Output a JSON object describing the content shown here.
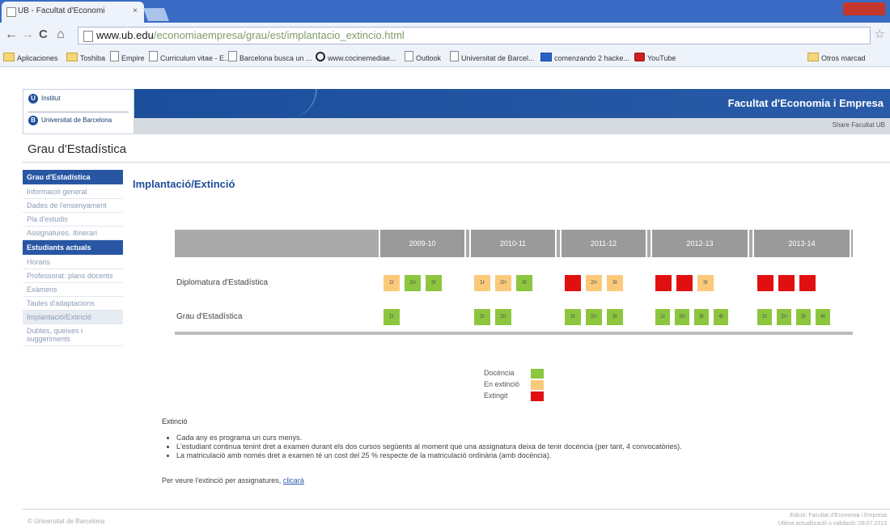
{
  "browser": {
    "tab_title": "UB - Facultat d'Economi",
    "tab_close": "×",
    "url_host": "www.ub.edu",
    "url_path": "/economiaempresa/grau/est/implantacio_extincio.html",
    "back": "←",
    "forward": "→",
    "reload": "C",
    "home": "⌂",
    "star": "☆"
  },
  "bookmarks": [
    {
      "label": "Aplicaciones",
      "icon": "apps-icon"
    },
    {
      "label": "Toshiba",
      "icon": "folder-icon"
    },
    {
      "label": "Empire",
      "icon": "page-icon"
    },
    {
      "label": "Curriculum vitae - E...",
      "icon": "page-icon"
    },
    {
      "label": "Barcelona busca un ...",
      "icon": "page-icon"
    },
    {
      "label": "www.cocinemediae...",
      "icon": "opera-icon"
    },
    {
      "label": "Outlook",
      "icon": "page-icon"
    },
    {
      "label": "Universitat de Barcel...",
      "icon": "page-icon"
    },
    {
      "label": "comenzando 2 hacke...",
      "icon": "blue-icon"
    },
    {
      "label": "YouTube",
      "icon": "youtube-icon"
    },
    {
      "label": "Otros marcad",
      "icon": "folder-icon"
    }
  ],
  "header": {
    "logo_top": "Institut",
    "logo_bottom": "Universitat de Barcelona",
    "faculty": "Facultat d'Economia i Empresa",
    "grey_links": "Share   Facultat   UB"
  },
  "site_title": "Grau d'Estadística",
  "sidebar": {
    "sections": [
      {
        "head": "Grau d'Estadística",
        "items": [
          "Informació general",
          "Dades de l'ensenyament",
          "Pla d'estudis",
          "Assignatures. Itinerari"
        ]
      },
      {
        "head": "Estudiants actuals",
        "items": [
          "Horaris",
          "Professorat: plans docents",
          "Exàmens",
          "Taules d'adaptacions",
          "Implantació/Extinció",
          "Dubtes, queixes i suggeriments"
        ]
      }
    ],
    "active": "Implantació/Extinció"
  },
  "main_title": "Implantació/Extinció",
  "timeline": {
    "years": [
      "2009-10",
      "2010-11",
      "2011-12",
      "2012-13",
      "2013-14"
    ],
    "rows": [
      {
        "label": "Diplomatura d'Estadística",
        "cells": [
          [
            {
              "label": "1r",
              "status": "extincio"
            },
            {
              "label": "2n",
              "status": "docencia"
            },
            {
              "label": "3r",
              "status": "docencia"
            }
          ],
          [
            {
              "label": "1r",
              "status": "extincio"
            },
            {
              "label": "2n",
              "status": "extincio"
            },
            {
              "label": "3r",
              "status": "docencia"
            }
          ],
          [
            {
              "label": "",
              "status": "extingit"
            },
            {
              "label": "2n",
              "status": "extincio"
            },
            {
              "label": "3r",
              "status": "extincio"
            }
          ],
          [
            {
              "label": "",
              "status": "extingit"
            },
            {
              "label": "",
              "status": "extingit"
            },
            {
              "label": "3r",
              "status": "extincio"
            }
          ],
          [
            {
              "label": "",
              "status": "extingit"
            },
            {
              "label": "",
              "status": "extingit"
            },
            {
              "label": "",
              "status": "extingit"
            }
          ]
        ]
      },
      {
        "label": "Grau d'Estadística",
        "cells": [
          [
            {
              "label": "1r",
              "status": "docencia"
            }
          ],
          [
            {
              "label": "1r",
              "status": "docencia"
            },
            {
              "label": "2n",
              "status": "docencia"
            }
          ],
          [
            {
              "label": "1r",
              "status": "docencia"
            },
            {
              "label": "2n",
              "status": "docencia"
            },
            {
              "label": "3r",
              "status": "docencia"
            }
          ],
          [
            {
              "label": "1r",
              "status": "docencia"
            },
            {
              "label": "2n",
              "status": "docencia"
            },
            {
              "label": "3r",
              "status": "docencia"
            },
            {
              "label": "4t",
              "status": "docencia"
            }
          ],
          [
            {
              "label": "1r",
              "status": "docencia"
            },
            {
              "label": "2n",
              "status": "docencia"
            },
            {
              "label": "3r",
              "status": "docencia"
            },
            {
              "label": "4t",
              "status": "docencia"
            }
          ]
        ]
      }
    ]
  },
  "colors": {
    "docencia": "#8cc63f",
    "extincio": "#fbc97a",
    "extingit": "#e01010"
  },
  "legend": [
    {
      "label": "Docència",
      "status": "docencia"
    },
    {
      "label": "En extinció",
      "status": "extincio"
    },
    {
      "label": "Extingit",
      "status": "extingit"
    }
  ],
  "notes": {
    "title": "Extinció",
    "items": [
      "Cada any es programa un curs menys.",
      "L'estudiant continua tenint dret a examen durant els dos cursos següents al moment que una assignatura deixa de tenir docència (per tant, 4 convocatòries).",
      "La matriculació amb només dret a examen té un cost del 25 % respecte de la matriculació ordinària (amb docència)."
    ],
    "see_more_text": "Per veure l'extinció per assignatures,",
    "see_more_link": "clicarà"
  },
  "footer": {
    "left": "© Universitat de Barcelona",
    "right_1": "Edició: Facultat d'Economia i Empresa",
    "right_2": "Última actualització o validació: 09.07.2013"
  }
}
